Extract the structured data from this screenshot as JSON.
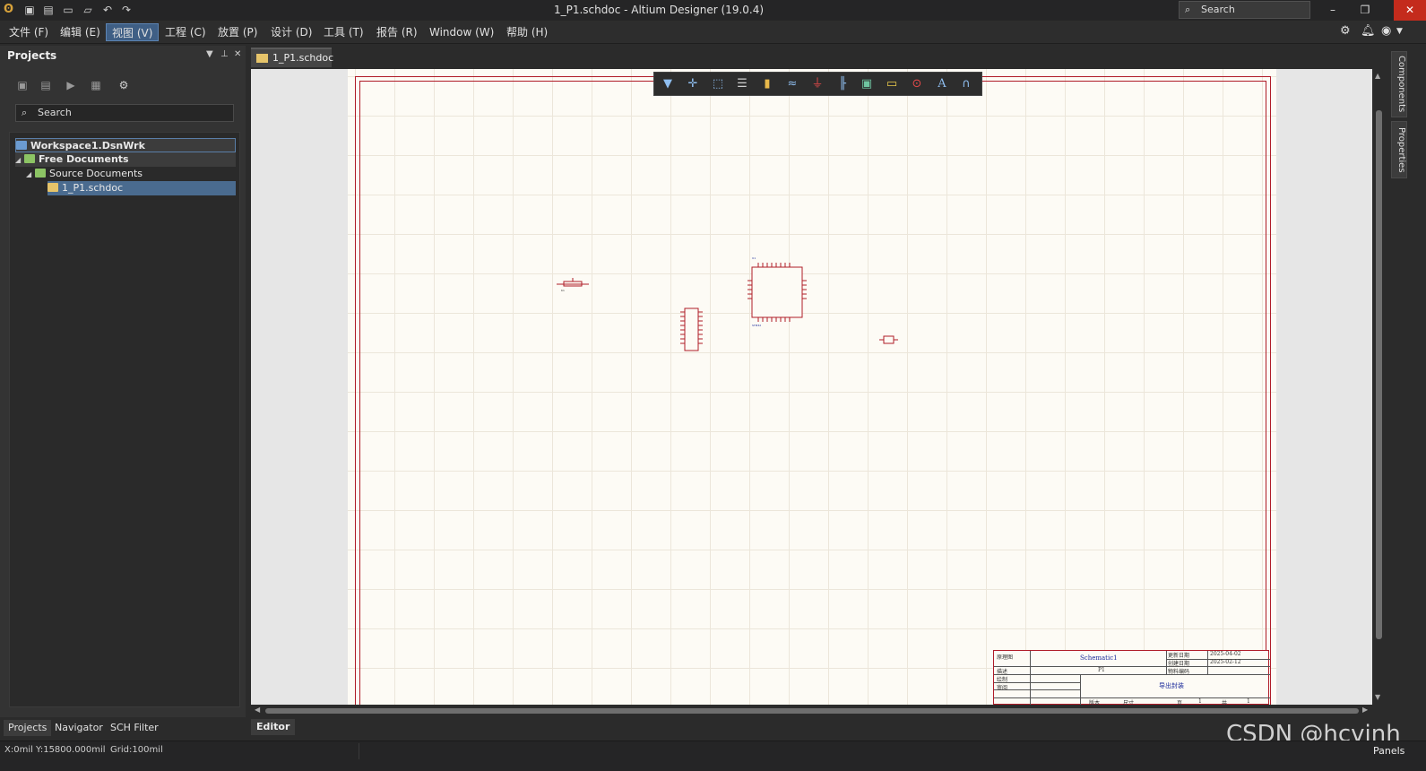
{
  "titlebar": {
    "title": "1_P1.schdoc - Altium Designer (19.0.4)",
    "search_placeholder": "Search",
    "minimize": "–",
    "restore": "❐",
    "close": "✕"
  },
  "menubar": {
    "items": [
      {
        "label": "文件 (F)"
      },
      {
        "label": "编辑 (E)"
      },
      {
        "label": "视图 (V)"
      },
      {
        "label": "工程 (C)"
      },
      {
        "label": "放置 (P)"
      },
      {
        "label": "设计 (D)"
      },
      {
        "label": "工具 (T)"
      },
      {
        "label": "报告 (R)"
      },
      {
        "label": "Window (W)"
      },
      {
        "label": "帮助 (H)"
      }
    ],
    "active_index": 2
  },
  "projects_panel": {
    "title": "Projects",
    "search_placeholder": "Search",
    "tree": {
      "workspace": "Workspace1.DsnWrk",
      "free_documents": "Free Documents",
      "source_documents": "Source Documents",
      "file": "1_P1.schdoc"
    },
    "tabs": [
      "Projects",
      "Navigator",
      "SCH Filter"
    ]
  },
  "document_tab": {
    "label": "1_P1.schdoc"
  },
  "editor_tab": {
    "label": "Editor"
  },
  "right_dock": {
    "tabs": [
      "Components",
      "Properties"
    ]
  },
  "title_block": {
    "title": "Schematic1",
    "date1": "2025-04-02",
    "date2": "2025-02-12",
    "sheet": "P1",
    "name": "导出封装",
    "lbl_a": "原理图",
    "lbl_b": "描述",
    "lbl_c": "绘制",
    "lbl_d": "审阅",
    "lbl_e": "更新日期",
    "lbl_f": "创建日期",
    "lbl_g": "物料编码",
    "lbl_h": "版本",
    "lbl_i": "尺寸",
    "lbl_j": "页",
    "lbl_k": "共",
    "page": "1",
    "total": "1"
  },
  "statusbar": {
    "coords": "X:0mil Y:15800.000mil",
    "grid": "Grid:100mil",
    "panels": "Panels"
  },
  "watermark": "CSDN @hcvinh",
  "colors": {
    "accent": "#3f5f85",
    "schematic_red": "#b01c28",
    "sheet_bg": "#fdfbf5"
  }
}
